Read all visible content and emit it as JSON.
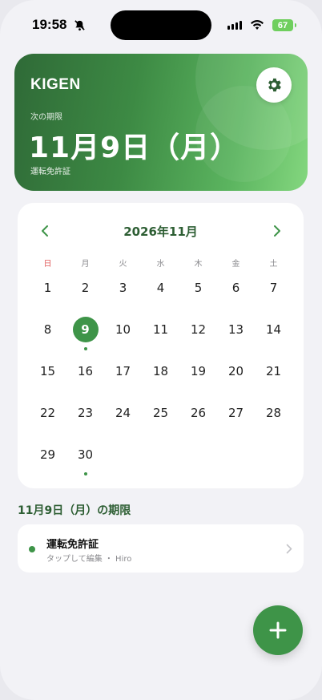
{
  "status_bar": {
    "time": "19:58",
    "battery": "67"
  },
  "header": {
    "app_name": "KIGEN",
    "next_label": "次の期限",
    "next_date": "11月9日（月）",
    "next_item": "運転免許証"
  },
  "calendar": {
    "title": "2026年11月",
    "weekdays": [
      "日",
      "月",
      "火",
      "水",
      "木",
      "金",
      "土"
    ],
    "days": [
      [
        1,
        2,
        3,
        4,
        5,
        6,
        7
      ],
      [
        8,
        9,
        10,
        11,
        12,
        13,
        14
      ],
      [
        15,
        16,
        17,
        18,
        19,
        20,
        21
      ],
      [
        22,
        23,
        24,
        25,
        26,
        27,
        28
      ],
      [
        29,
        30
      ]
    ],
    "selected_day": 9,
    "days_with_deadlines": [
      9,
      30
    ]
  },
  "deadlines": {
    "section_title": "11月9日（月）の期限",
    "items": [
      {
        "title": "運転免許証",
        "subtitle": "タップして編集 ・ Hiro"
      }
    ]
  },
  "colors": {
    "accent": "#3e9448",
    "accent_dark": "#2d5e33",
    "sunday": "#e05b5b"
  }
}
